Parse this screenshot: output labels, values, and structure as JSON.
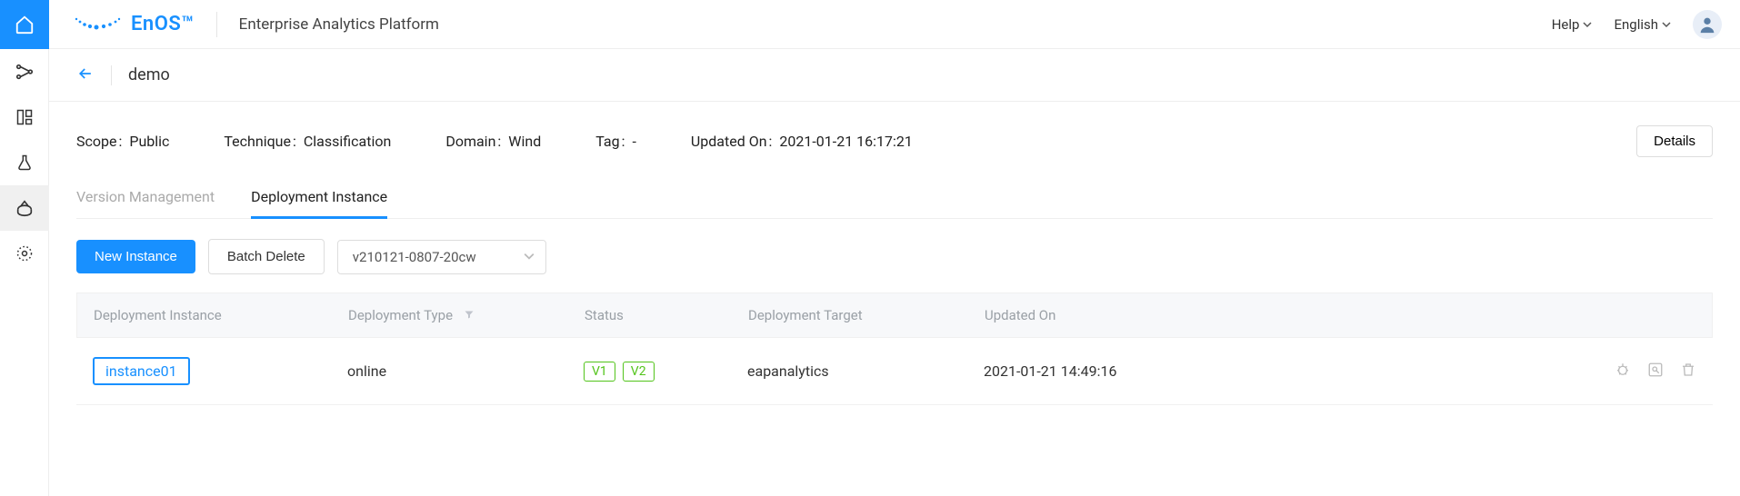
{
  "brand": {
    "name": "EnOS™",
    "platform": "Enterprise Analytics Platform"
  },
  "topnav": {
    "help": "Help",
    "language": "English"
  },
  "breadcrumb": {
    "title": "demo"
  },
  "meta": {
    "scope_label": "Scope",
    "scope_value": "Public",
    "technique_label": "Technique",
    "technique_value": "Classification",
    "domain_label": "Domain",
    "domain_value": "Wind",
    "tag_label": "Tag",
    "tag_value": "-",
    "updated_label": "Updated On",
    "updated_value": "2021-01-21 16:17:21",
    "details_btn": "Details"
  },
  "tabs": {
    "version_mgmt": "Version Management",
    "deployment": "Deployment Instance"
  },
  "toolbar": {
    "new_instance": "New Instance",
    "batch_delete": "Batch Delete",
    "version_selected": "v210121-0807-20cw"
  },
  "table": {
    "headers": {
      "instance": "Deployment Instance",
      "type": "Deployment Type",
      "status": "Status",
      "target": "Deployment Target",
      "updated": "Updated On"
    },
    "rows": [
      {
        "instance": "instance01",
        "type": "online",
        "status_badges": [
          "V1",
          "V2"
        ],
        "target": "eapanalytics",
        "updated": "2021-01-21 14:49:16"
      }
    ]
  }
}
